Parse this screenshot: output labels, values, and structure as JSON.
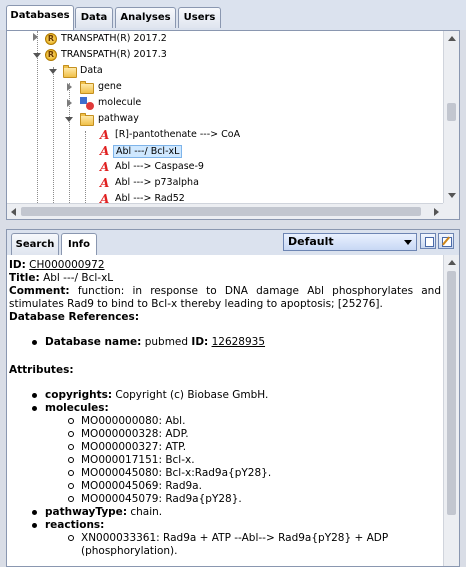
{
  "tabs": [
    "Databases",
    "Data",
    "Analyses",
    "Users"
  ],
  "tree": {
    "items": [
      {
        "label": "TRANSPATH(R) 2017.2",
        "icon": "r-icon"
      },
      {
        "label": "TRANSPATH(R) 2017.3",
        "icon": "r-icon"
      },
      {
        "label": "Data",
        "icon": "folder-icon"
      },
      {
        "label": "gene",
        "icon": "folder-icon"
      },
      {
        "label": "molecule",
        "icon": "molecule-icon"
      },
      {
        "label": "pathway",
        "icon": "folder-icon"
      },
      {
        "label": "[R]-pantothenate ---> CoA",
        "icon": "reaction-icon"
      },
      {
        "label": "Abl ---/ Bcl-xL",
        "icon": "reaction-icon"
      },
      {
        "label": "Abl ---> Caspase-9",
        "icon": "reaction-icon"
      },
      {
        "label": "Abl ---> p73alpha",
        "icon": "reaction-icon"
      },
      {
        "label": "Abl ---> Rad52",
        "icon": "reaction-icon"
      }
    ],
    "r_glyph": "R",
    "a_glyph": "A"
  },
  "info_tabs": [
    "Search",
    "Info"
  ],
  "view_select": {
    "value": "Default"
  },
  "info": {
    "id_label": "ID",
    "id_value": "CH000000972",
    "title_label": "Title",
    "title_value": "Abl ---/ Bcl-xL",
    "comment_label": "Comment",
    "comment_value": "function: in response to DNA damage Abl phosphorylates and stimulates Rad9 to bind to Bcl-x thereby leading to apoptosis; [25276].",
    "dbrefs_label": "Database References",
    "dbname_label": "Database name",
    "dbname_value": "pubmed",
    "dbid_label": "ID",
    "dbid_value": "12628935",
    "attributes_label": "Attributes",
    "copyrights_label": "copyrights",
    "copyrights_value": "Copyright (c) Biobase GmbH.",
    "molecules_label": "molecules",
    "molecules": [
      "MO000000080: Abl.",
      "MO000000328: ADP.",
      "MO000000327: ATP.",
      "MO000017151: Bcl-x.",
      "MO000045080: Bcl-x:Rad9a{pY28}.",
      "MO000045069: Rad9a.",
      "MO000045079: Rad9a{pY28}."
    ],
    "pathwaytype_label": "pathwayType",
    "pathwaytype_value": "chain.",
    "reactions_label": "reactions",
    "reactions": [
      "XN000033361: Rad9a + ATP --Abl--> Rad9a{pY28} + ADP (phosphorylation)."
    ]
  }
}
